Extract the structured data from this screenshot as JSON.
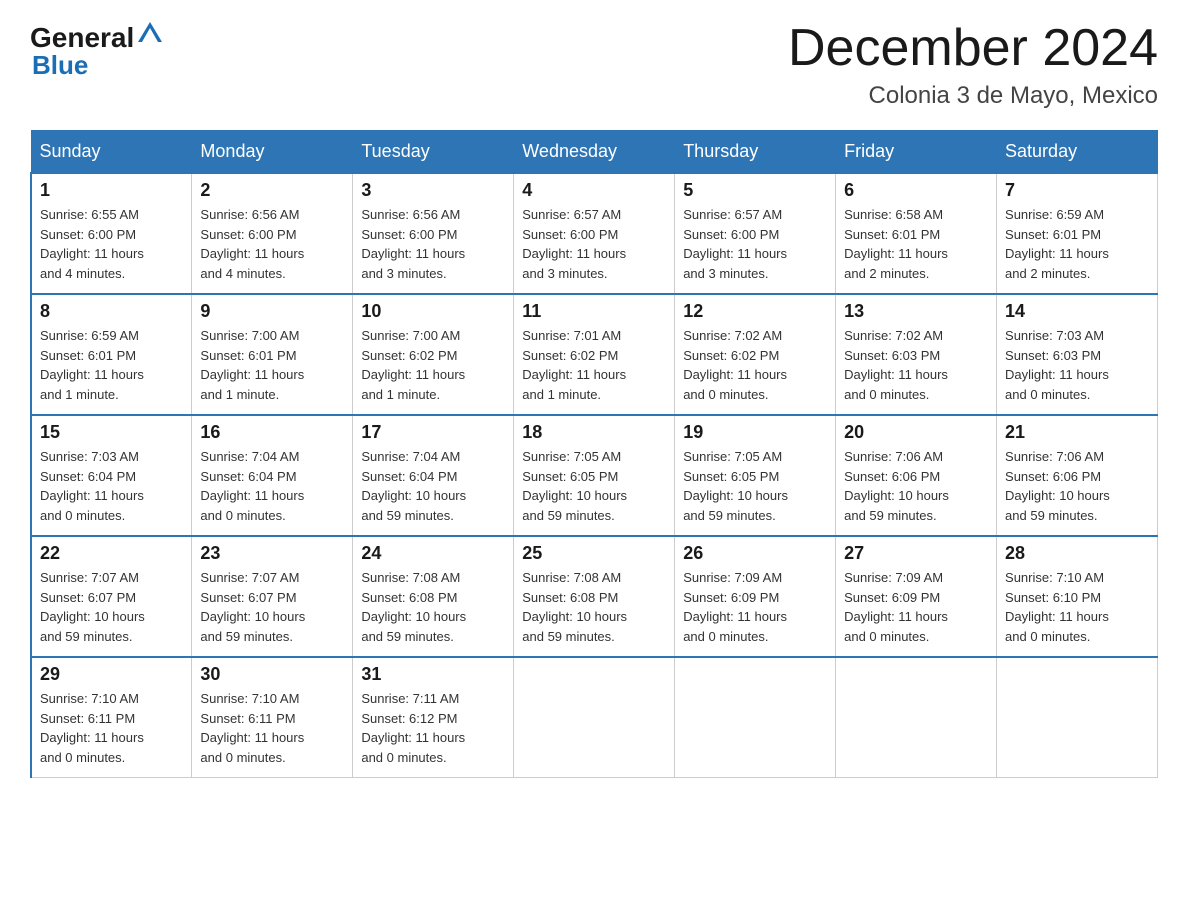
{
  "header": {
    "logo_general": "General",
    "logo_blue": "Blue",
    "calendar_title": "December 2024",
    "calendar_subtitle": "Colonia 3 de Mayo, Mexico"
  },
  "days_of_week": [
    "Sunday",
    "Monday",
    "Tuesday",
    "Wednesday",
    "Thursday",
    "Friday",
    "Saturday"
  ],
  "weeks": [
    [
      {
        "day": "1",
        "sunrise": "6:55 AM",
        "sunset": "6:00 PM",
        "daylight": "11 hours and 4 minutes."
      },
      {
        "day": "2",
        "sunrise": "6:56 AM",
        "sunset": "6:00 PM",
        "daylight": "11 hours and 4 minutes."
      },
      {
        "day": "3",
        "sunrise": "6:56 AM",
        "sunset": "6:00 PM",
        "daylight": "11 hours and 3 minutes."
      },
      {
        "day": "4",
        "sunrise": "6:57 AM",
        "sunset": "6:00 PM",
        "daylight": "11 hours and 3 minutes."
      },
      {
        "day": "5",
        "sunrise": "6:57 AM",
        "sunset": "6:00 PM",
        "daylight": "11 hours and 3 minutes."
      },
      {
        "day": "6",
        "sunrise": "6:58 AM",
        "sunset": "6:01 PM",
        "daylight": "11 hours and 2 minutes."
      },
      {
        "day": "7",
        "sunrise": "6:59 AM",
        "sunset": "6:01 PM",
        "daylight": "11 hours and 2 minutes."
      }
    ],
    [
      {
        "day": "8",
        "sunrise": "6:59 AM",
        "sunset": "6:01 PM",
        "daylight": "11 hours and 1 minute."
      },
      {
        "day": "9",
        "sunrise": "7:00 AM",
        "sunset": "6:01 PM",
        "daylight": "11 hours and 1 minute."
      },
      {
        "day": "10",
        "sunrise": "7:00 AM",
        "sunset": "6:02 PM",
        "daylight": "11 hours and 1 minute."
      },
      {
        "day": "11",
        "sunrise": "7:01 AM",
        "sunset": "6:02 PM",
        "daylight": "11 hours and 1 minute."
      },
      {
        "day": "12",
        "sunrise": "7:02 AM",
        "sunset": "6:02 PM",
        "daylight": "11 hours and 0 minutes."
      },
      {
        "day": "13",
        "sunrise": "7:02 AM",
        "sunset": "6:03 PM",
        "daylight": "11 hours and 0 minutes."
      },
      {
        "day": "14",
        "sunrise": "7:03 AM",
        "sunset": "6:03 PM",
        "daylight": "11 hours and 0 minutes."
      }
    ],
    [
      {
        "day": "15",
        "sunrise": "7:03 AM",
        "sunset": "6:04 PM",
        "daylight": "11 hours and 0 minutes."
      },
      {
        "day": "16",
        "sunrise": "7:04 AM",
        "sunset": "6:04 PM",
        "daylight": "11 hours and 0 minutes."
      },
      {
        "day": "17",
        "sunrise": "7:04 AM",
        "sunset": "6:04 PM",
        "daylight": "10 hours and 59 minutes."
      },
      {
        "day": "18",
        "sunrise": "7:05 AM",
        "sunset": "6:05 PM",
        "daylight": "10 hours and 59 minutes."
      },
      {
        "day": "19",
        "sunrise": "7:05 AM",
        "sunset": "6:05 PM",
        "daylight": "10 hours and 59 minutes."
      },
      {
        "day": "20",
        "sunrise": "7:06 AM",
        "sunset": "6:06 PM",
        "daylight": "10 hours and 59 minutes."
      },
      {
        "day": "21",
        "sunrise": "7:06 AM",
        "sunset": "6:06 PM",
        "daylight": "10 hours and 59 minutes."
      }
    ],
    [
      {
        "day": "22",
        "sunrise": "7:07 AM",
        "sunset": "6:07 PM",
        "daylight": "10 hours and 59 minutes."
      },
      {
        "day": "23",
        "sunrise": "7:07 AM",
        "sunset": "6:07 PM",
        "daylight": "10 hours and 59 minutes."
      },
      {
        "day": "24",
        "sunrise": "7:08 AM",
        "sunset": "6:08 PM",
        "daylight": "10 hours and 59 minutes."
      },
      {
        "day": "25",
        "sunrise": "7:08 AM",
        "sunset": "6:08 PM",
        "daylight": "10 hours and 59 minutes."
      },
      {
        "day": "26",
        "sunrise": "7:09 AM",
        "sunset": "6:09 PM",
        "daylight": "11 hours and 0 minutes."
      },
      {
        "day": "27",
        "sunrise": "7:09 AM",
        "sunset": "6:09 PM",
        "daylight": "11 hours and 0 minutes."
      },
      {
        "day": "28",
        "sunrise": "7:10 AM",
        "sunset": "6:10 PM",
        "daylight": "11 hours and 0 minutes."
      }
    ],
    [
      {
        "day": "29",
        "sunrise": "7:10 AM",
        "sunset": "6:11 PM",
        "daylight": "11 hours and 0 minutes."
      },
      {
        "day": "30",
        "sunrise": "7:10 AM",
        "sunset": "6:11 PM",
        "daylight": "11 hours and 0 minutes."
      },
      {
        "day": "31",
        "sunrise": "7:11 AM",
        "sunset": "6:12 PM",
        "daylight": "11 hours and 0 minutes."
      },
      null,
      null,
      null,
      null
    ]
  ],
  "labels": {
    "sunrise": "Sunrise:",
    "sunset": "Sunset:",
    "daylight": "Daylight:"
  }
}
